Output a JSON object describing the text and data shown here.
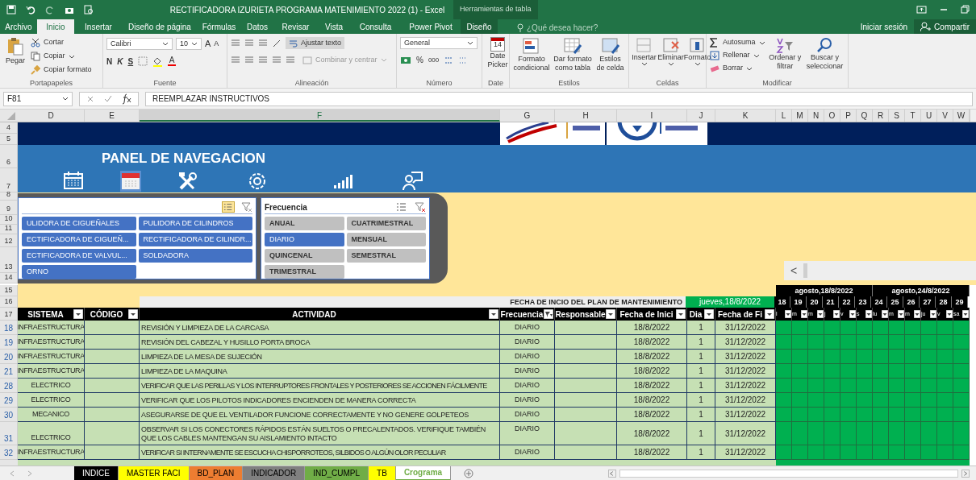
{
  "window": {
    "title": "RECTIFICADORA IZURIETA PROGRAMA MATENIMIENTO 2022 (1) - Excel",
    "context_tab": "Herramientas de tabla"
  },
  "ribbon_tabs": [
    {
      "label": "Archivo",
      "selected": false
    },
    {
      "label": "Inicio",
      "selected": true
    },
    {
      "label": "Insertar",
      "selected": false
    },
    {
      "label": "Diseño de página",
      "selected": false
    },
    {
      "label": "Fórmulas",
      "selected": false
    },
    {
      "label": "Datos",
      "selected": false
    },
    {
      "label": "Revisar",
      "selected": false
    },
    {
      "label": "Vista",
      "selected": false
    },
    {
      "label": "Consulta",
      "selected": false
    },
    {
      "label": "Power Pivot",
      "selected": false
    },
    {
      "label": "Diseño",
      "selected": false
    }
  ],
  "tell_me": {
    "placeholder": "¿Qué desea hacer?"
  },
  "account": {
    "sign_in": "Iniciar sesión",
    "share": "Compartir"
  },
  "ribbon": {
    "clipboard": {
      "label": "Portapapeles",
      "paste": "Pegar",
      "cut": "Cortar",
      "copy": "Copiar",
      "format_painter": "Copiar formato"
    },
    "font": {
      "label": "Fuente",
      "family": "Calibri",
      "size": "10",
      "bold": "N",
      "italic": "K",
      "underline": "S",
      "grow": "A",
      "shrink": "A",
      "font_color_label": "A"
    },
    "alignment": {
      "label": "Alineación",
      "wrap": "Ajustar texto",
      "merge": "Combinar y centrar"
    },
    "number": {
      "label": "Número",
      "format": "General",
      "percent": "%",
      "thousands": "000"
    },
    "date": {
      "label": "Date",
      "day": "14",
      "button": "Date Picker"
    },
    "styles": {
      "label": "Estilos",
      "buttons": [
        "Formato condicional",
        "Dar formato como tabla",
        "Estilos de celda"
      ]
    },
    "cells": {
      "label": "Celdas",
      "buttons": [
        "Insertar",
        "Eliminar",
        "Formato"
      ]
    },
    "editing": {
      "label": "Modificar",
      "autosum": "Autosuma",
      "fill": "Rellenar",
      "clear": "Borrar",
      "sort": "Ordenar y filtrar",
      "find": "Buscar y seleccionar"
    }
  },
  "formula_bar": {
    "name_box": "F81",
    "formula": "REEMPLAZAR INSTRUCTIVOS"
  },
  "columns": [
    "D",
    "E",
    "F",
    "G",
    "H",
    "I",
    "J",
    "K",
    "L",
    "M",
    "N",
    "O",
    "P",
    "Q",
    "R",
    "S",
    "T",
    "U",
    "V",
    "W"
  ],
  "timeline_scroll": {
    "left": "<"
  },
  "banner": {
    "row_numbers": [
      "4",
      "5",
      "6",
      "7",
      "8",
      "9",
      "10",
      "11",
      "12",
      "13",
      "14",
      "15"
    ],
    "title": "PANEL DE NAVEGACION",
    "nav_icons": [
      {
        "kind": "calendar",
        "selected": false
      },
      {
        "kind": "planner",
        "selected": true
      },
      {
        "kind": "tools",
        "selected": false
      },
      {
        "kind": "gear",
        "selected": false
      },
      {
        "kind": "bars",
        "selected": false
      },
      {
        "kind": "presenter",
        "selected": false
      }
    ]
  },
  "slicers": [
    {
      "items": [
        {
          "label": "ULIDORA DE CIGUEÑALES",
          "selected": true
        },
        {
          "label": "PULIDORA DE CILINDROS",
          "selected": true
        },
        {
          "label": "ECTIFICADORA DE CIGUEÑ...",
          "selected": true
        },
        {
          "label": "RECTIFICADORA DE CILINDR...",
          "selected": true
        },
        {
          "label": "ECTIFICADORA DE VALVUL...",
          "selected": true
        },
        {
          "label": "SOLDADORA",
          "selected": true
        },
        {
          "label": "ORNO",
          "selected": true
        }
      ],
      "multi_select": true
    },
    {
      "title": "Frecuencia",
      "items": [
        {
          "label": "ANUAL",
          "selected": false
        },
        {
          "label": "CUATRIMESTRAL",
          "selected": false
        },
        {
          "label": "DIARIO",
          "selected": true
        },
        {
          "label": "MENSUAL",
          "selected": false
        },
        {
          "label": "QUINCENAL",
          "selected": false
        },
        {
          "label": "SEMESTRAL",
          "selected": false
        },
        {
          "label": "TRIMESTRAL",
          "selected": false
        }
      ],
      "multi_select": false
    }
  ],
  "plan": {
    "row_numbers": [
      "16",
      "17"
    ],
    "start_label": "FECHA DE INCIO DEL PLAN DE MANTENIMIENTO",
    "start_date": "jueves,18/8/2022",
    "weeks": [
      "agosto,18/8/2022",
      "agosto,24/8/2022"
    ],
    "days": [
      "18",
      "19",
      "20",
      "21",
      "22",
      "23",
      "24",
      "25",
      "26",
      "27",
      "28",
      "29"
    ],
    "day_letters": [
      "l",
      "m",
      "m",
      "j",
      "v",
      "s",
      "lu",
      "m",
      "m",
      "ju",
      "v",
      "sa"
    ]
  },
  "table": {
    "columns": [
      {
        "label": "SISTEMA",
        "filtered": false
      },
      {
        "label": "CÓDIGO",
        "filtered": false
      },
      {
        "label": "ACTIVIDAD",
        "filtered": false
      },
      {
        "label": "Frecuencia",
        "filtered": true
      },
      {
        "label": "Responsable",
        "filtered": false
      },
      {
        "label": "Fecha de Inici",
        "filtered": false
      },
      {
        "label": "Dia",
        "filtered": false
      },
      {
        "label": "Fecha de Fi",
        "filtered": false
      }
    ],
    "rows": [
      {
        "row": "18",
        "sistema": "INFRAESTRUCTURA",
        "actividad": "REVISIÓN Y LIMPIEZA DE LA CARCASA",
        "frecuencia": "DIARIO",
        "inicio": "18/8/2022",
        "dia": "1",
        "fin": "31/12/2022"
      },
      {
        "row": "19",
        "sistema": "INFRAESTRUCTURA",
        "actividad": "REVISIÓN DEL CABEZAL Y HUSILLO PORTA BROCA",
        "frecuencia": "DIARIO",
        "inicio": "18/8/2022",
        "dia": "1",
        "fin": "31/12/2022"
      },
      {
        "row": "20",
        "sistema": "INFRAESTRUCTURA",
        "actividad": "LIMPIEZA DE LA MESA DE SUJECIÓN",
        "frecuencia": "DIARIO",
        "inicio": "18/8/2022",
        "dia": "1",
        "fin": "31/12/2022"
      },
      {
        "row": "21",
        "sistema": "INFRAESTRUCTURA",
        "actividad": "LIMPIEZA DE LA MAQUINA",
        "frecuencia": "DIARIO",
        "inicio": "18/8/2022",
        "dia": "1",
        "fin": "31/12/2022"
      },
      {
        "row": "28",
        "sistema": "ELECTRICO",
        "actividad": "VERIFICAR QUE LAS PERILLAS Y LOS INTERRUPTORES FRONTALES Y POSTERIORES SE ACCIONEN FÁCILMENTE",
        "frecuencia": "DIARIO",
        "inicio": "18/8/2022",
        "dia": "1",
        "fin": "31/12/2022"
      },
      {
        "row": "29",
        "sistema": "ELECTRICO",
        "actividad": "VERIFICAR QUE LOS PILOTOS INDICADORES ENCIENDEN DE MANERA CORRECTA",
        "frecuencia": "DIARIO",
        "inicio": "18/8/2022",
        "dia": "1",
        "fin": "31/12/2022"
      },
      {
        "row": "30",
        "sistema": "MECANICO",
        "actividad": "ASEGURARSE DE QUE EL VENTILADOR FUNCIONE CORRECTAMENTE Y NO GENERE GOLPETEOS",
        "frecuencia": "DIARIO",
        "inicio": "18/8/2022",
        "dia": "1",
        "fin": "31/12/2022"
      },
      {
        "row": "31",
        "sistema": "ELECTRICO",
        "actividad": "OBSERVAR SI LOS CONECTORES RÁPIDOS ESTÁN SUELTOS O PRECALENTADOS. VERIFIQUE TAMBIÉN QUE LOS CABLES MANTENGAN SU AISLAMIENTO INTACTO",
        "frecuencia": "DIARIO",
        "inicio": "18/8/2022",
        "dia": "1",
        "fin": "31/12/2022"
      },
      {
        "row": "32",
        "sistema": "INFRAESTRUCTURA",
        "actividad": "VERIFICAR SI INTERNAMENTE SE ESCUCHA CHISPORROTEOS, SILBIDOS O ALGÚN OLOR PECULIAR",
        "frecuencia": "DIARIO",
        "inicio": "18/8/2022",
        "dia": "1",
        "fin": "31/12/2022"
      }
    ]
  },
  "sheet_tabs": [
    {
      "label": "INDICE",
      "color": "#000000",
      "selected": false
    },
    {
      "label": "MASTER FACI",
      "color": "#ffff00",
      "selected": false
    },
    {
      "label": "BD_PLAN",
      "color": "#ed7d31",
      "selected": false
    },
    {
      "label": "INDICADOR",
      "color": "#808080",
      "selected": false
    },
    {
      "label": "IND_CUMPL",
      "color": "#70ad47",
      "selected": false
    },
    {
      "label": "TB",
      "color": "#ffff00",
      "selected": false
    },
    {
      "label": "Crograma",
      "color": "#70ad47",
      "selected": true
    }
  ]
}
